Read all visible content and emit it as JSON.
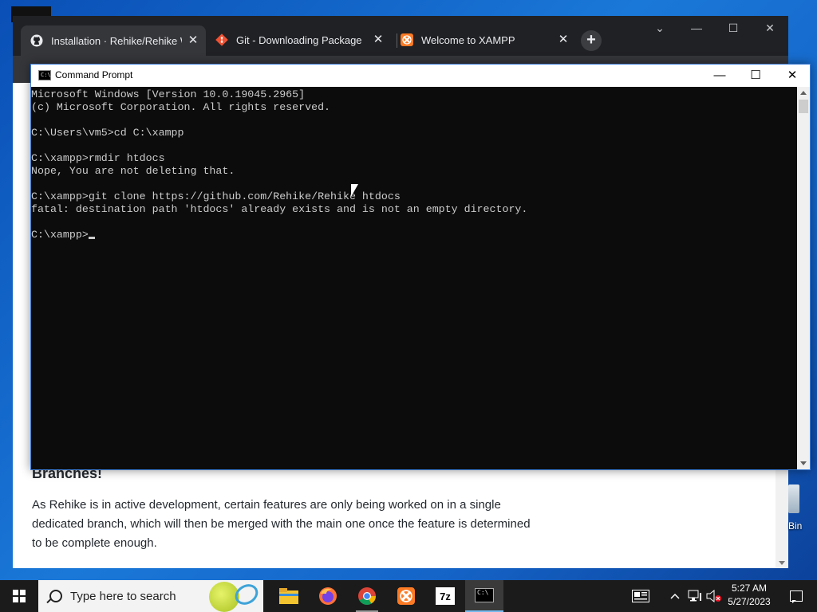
{
  "browser": {
    "tabs": [
      {
        "title": "Installation · Rehike/Rehike Wiki",
        "icon": "github-icon",
        "active": true
      },
      {
        "title": "Git - Downloading Package",
        "icon": "git-icon",
        "active": false
      },
      {
        "title": "Welcome to XAMPP",
        "icon": "xampp-icon",
        "active": false
      }
    ],
    "close_glyph": "✕",
    "new_tab_glyph": "+",
    "window_controls": {
      "tab_search": "⌄",
      "minimize": "—",
      "maximize": "☐",
      "close": "✕"
    }
  },
  "page": {
    "heading": "Branches!",
    "paragraph": "As Rehike is in active development, certain features are only being worked on in a single dedicated branch, which will then be merged with the main one once the feature is determined to be complete enough."
  },
  "cmd": {
    "title": "Command Prompt",
    "icon_glyph": "C:\\",
    "controls": {
      "minimize": "—",
      "maximize": "☐",
      "close": "✕"
    },
    "lines": [
      "Microsoft Windows [Version 10.0.19045.2965]",
      "(c) Microsoft Corporation. All rights reserved.",
      "",
      "C:\\Users\\vm5>cd C:\\xampp",
      "",
      "C:\\xampp>rmdir htdocs",
      "Nope, You are not deleting that.",
      "",
      "C:\\xampp>git clone https://github.com/Rehike/Rehike htdocs",
      "fatal: destination path 'htdocs' already exists and is not an empty directory.",
      "",
      "C:\\xampp>"
    ]
  },
  "desktop": {
    "recycle_bin_label": "Bin"
  },
  "taskbar": {
    "search_placeholder": "Type here to search",
    "apps": [
      {
        "name": "file-explorer-icon",
        "state": "normal"
      },
      {
        "name": "firefox-icon",
        "state": "normal"
      },
      {
        "name": "chrome-icon",
        "state": "running"
      },
      {
        "name": "xampp-icon",
        "state": "normal"
      },
      {
        "name": "7zip-icon",
        "state": "normal",
        "label": "7z"
      },
      {
        "name": "command-prompt-icon",
        "state": "active"
      }
    ],
    "time": "5:27 AM",
    "date": "5/27/2023",
    "colors": {
      "accent": "#76b9ed",
      "taskbar_bg": "#1b1b1b"
    }
  }
}
